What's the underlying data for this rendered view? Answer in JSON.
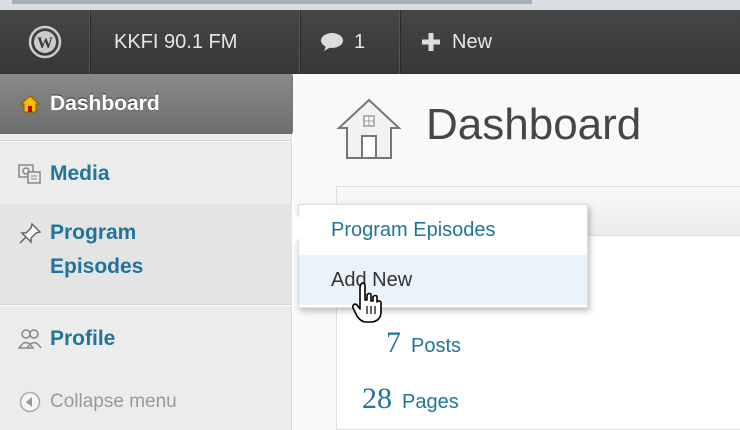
{
  "adminbar": {
    "site_name": "KKFI 90.1 FM",
    "comments_count": "1",
    "new_label": "New"
  },
  "sidebar": {
    "items": [
      {
        "label": "Dashboard",
        "icon": "house-icon"
      },
      {
        "label": "Media",
        "icon": "media-icon"
      },
      {
        "label": "Program Episodes",
        "line1": "Program",
        "line2": "Episodes",
        "icon": "pin-icon"
      },
      {
        "label": "Profile",
        "icon": "users-icon"
      },
      {
        "label": "Collapse menu",
        "icon": "collapse-icon"
      }
    ]
  },
  "flyout": {
    "items": [
      {
        "label": "Program Episodes"
      },
      {
        "label": "Add New"
      }
    ]
  },
  "main": {
    "title": "Dashboard",
    "stats": [
      {
        "count": "7",
        "label": "Posts"
      },
      {
        "count": "28",
        "label": "Pages"
      }
    ]
  },
  "colors": {
    "link": "#21759b",
    "adminbar": "#464646",
    "sidebar_bg": "#ececec",
    "active_menu": "#7b7b7b"
  }
}
